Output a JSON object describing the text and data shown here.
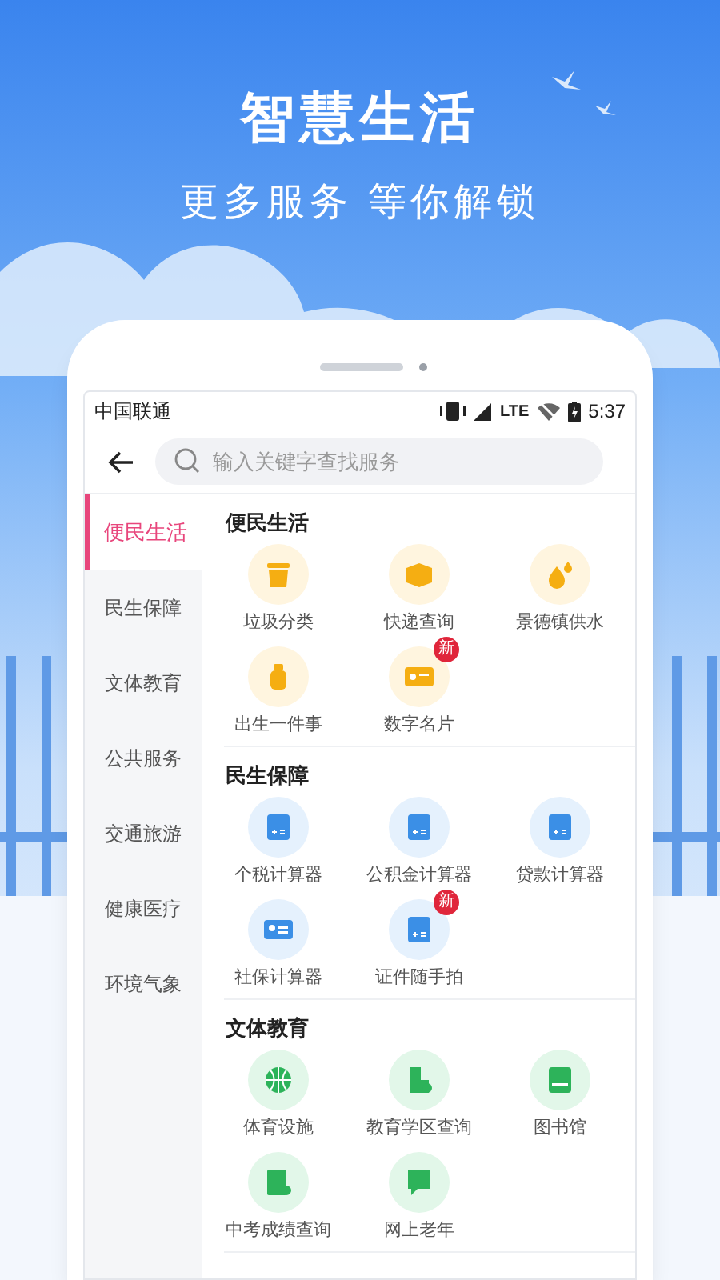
{
  "headline": "智慧生活",
  "tagline": "更多服务 等你解锁",
  "status_bar": {
    "carrier": "中国联通",
    "network": "LTE",
    "time": "5:37"
  },
  "search": {
    "placeholder": "输入关键字查找服务"
  },
  "sidebar": {
    "items": [
      {
        "label": "便民生活",
        "selected": true
      },
      {
        "label": "民生保障",
        "selected": false
      },
      {
        "label": "文体教育",
        "selected": false
      },
      {
        "label": "公共服务",
        "selected": false
      },
      {
        "label": "交通旅游",
        "selected": false
      },
      {
        "label": "健康医疗",
        "selected": false
      },
      {
        "label": "环境气象",
        "selected": false
      }
    ]
  },
  "sections": [
    {
      "title": "便民生活",
      "items": [
        {
          "label": "垃圾分类"
        },
        {
          "label": "快递查询"
        },
        {
          "label": "景德镇供水"
        },
        {
          "label": "出生一件事"
        },
        {
          "label": "数字名片",
          "badge": "新"
        }
      ]
    },
    {
      "title": "民生保障",
      "items": [
        {
          "label": "个税计算器"
        },
        {
          "label": "公积金计算器"
        },
        {
          "label": "贷款计算器"
        },
        {
          "label": "社保计算器"
        },
        {
          "label": "证件随手拍",
          "badge": "新"
        }
      ]
    },
    {
      "title": "文体教育",
      "items": [
        {
          "label": "体育设施"
        },
        {
          "label": "教育学区查询"
        },
        {
          "label": "图书馆"
        },
        {
          "label": "中考成绩查询"
        },
        {
          "label": "网上老年"
        }
      ]
    }
  ]
}
